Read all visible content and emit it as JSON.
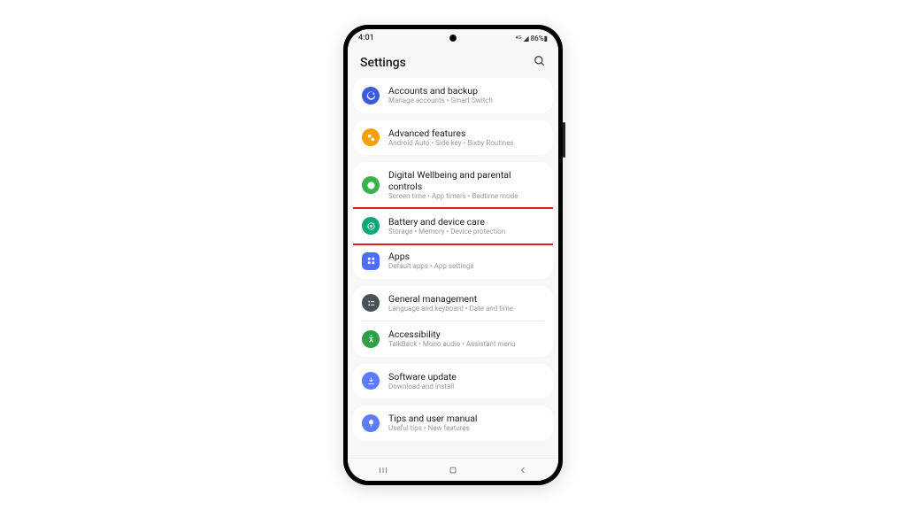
{
  "status": {
    "time": "4:01",
    "icons": "✕",
    "signal": "⁴ᴳ ◢ 86%▮"
  },
  "header": {
    "title": "Settings"
  },
  "groups": [
    {
      "items": [
        {
          "id": "accounts",
          "icon_bg": "#3b5bdb",
          "icon": "sync",
          "title": "Accounts and backup",
          "desc": "Manage accounts  •  Smart Switch",
          "highlight": false
        }
      ]
    },
    {
      "items": [
        {
          "id": "advanced",
          "icon_bg": "#f59f00",
          "icon": "advanced",
          "title": "Advanced features",
          "desc": "Android Auto  •  Side key  •  Bixby Routines",
          "highlight": false
        }
      ]
    },
    {
      "items": [
        {
          "id": "wellbeing",
          "icon_bg": "#37b24d",
          "icon": "wellbeing",
          "title": "Digital Wellbeing and parental controls",
          "desc": "Screen time  •  App timers  •  Bedtime mode",
          "highlight": false
        },
        {
          "id": "battery",
          "icon_bg": "#0ca678",
          "icon": "care",
          "title": "Battery and device care",
          "desc": "Storage  •  Memory  •  Device protection",
          "highlight": true
        },
        {
          "id": "apps",
          "icon_bg": "#4c6ef5",
          "icon": "apps",
          "title": "Apps",
          "desc": "Default apps  •  App settings",
          "highlight": false
        }
      ]
    },
    {
      "items": [
        {
          "id": "general",
          "icon_bg": "#495057",
          "icon": "general",
          "title": "General management",
          "desc": "Language and keyboard  •  Date and time",
          "highlight": false
        },
        {
          "id": "accessibility",
          "icon_bg": "#2f9e44",
          "icon": "accessibility",
          "title": "Accessibility",
          "desc": "TalkBack  •  Mono audio  •  Assistant menu",
          "highlight": false
        }
      ]
    },
    {
      "items": [
        {
          "id": "update",
          "icon_bg": "#5c7cfa",
          "icon": "update",
          "title": "Software update",
          "desc": "Download and install",
          "highlight": false
        }
      ]
    },
    {
      "items": [
        {
          "id": "tips",
          "icon_bg": "#5c7cfa",
          "icon": "tips",
          "title": "Tips and user manual",
          "desc": "Useful tips  •  New features",
          "highlight": false
        }
      ]
    }
  ]
}
